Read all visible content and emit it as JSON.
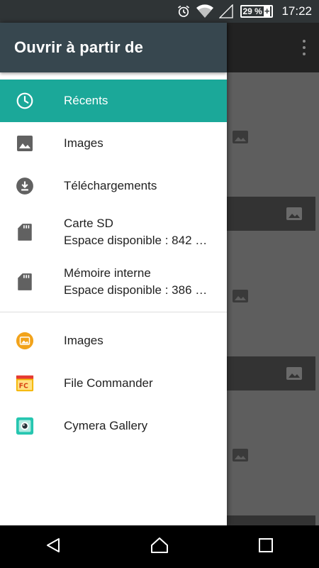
{
  "status_bar": {
    "battery": "29 %",
    "battery_plus": "+",
    "time": "17:22",
    "icons": [
      "alarm-icon",
      "wifi-icon",
      "signal-icon",
      "battery-icon"
    ]
  },
  "drawer": {
    "title": "Ouvrir à partir de",
    "items": [
      {
        "label": "Récents",
        "icon": "clock-icon"
      },
      {
        "label": "Images",
        "icon": "image-icon"
      },
      {
        "label": "Téléchargements",
        "icon": "download-icon"
      },
      {
        "label": "Carte SD",
        "sub": "Espace disponible : 842 …",
        "icon": "sd-card-icon"
      },
      {
        "label": "Mémoire interne",
        "sub": "Espace disponible : 386 …",
        "icon": "sd-card-icon"
      }
    ],
    "apps": [
      {
        "label": "Images",
        "icon": "gallery-app-icon"
      },
      {
        "label": "File Commander",
        "icon": "file-commander-app-icon"
      },
      {
        "label": "Cymera Gallery",
        "icon": "cymera-app-icon"
      }
    ]
  },
  "colors": {
    "header": "#37474f",
    "accent": "#1ba899"
  },
  "nav": {
    "buttons": [
      "back-icon",
      "home-icon",
      "recents-icon"
    ]
  }
}
